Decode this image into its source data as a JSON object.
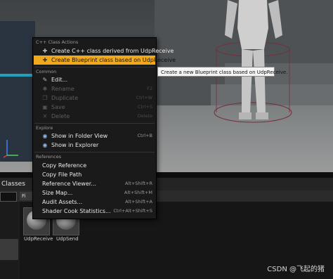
{
  "menu": {
    "sections": [
      {
        "header": "C++ Class Actions",
        "items": [
          {
            "label": "Create C++ class derived from UdpReceive",
            "shortcut": "",
            "icon": "cpp-class-icon",
            "disabled": false,
            "highlighted": false
          },
          {
            "label": "Create Blueprint class based on UdpReceive",
            "shortcut": "",
            "icon": "blueprint-class-icon",
            "disabled": false,
            "highlighted": true
          }
        ]
      },
      {
        "header": "Common",
        "items": [
          {
            "label": "Edit...",
            "shortcut": "",
            "icon": "edit-icon",
            "disabled": false
          },
          {
            "label": "Rename",
            "shortcut": "F2",
            "icon": "rename-icon",
            "disabled": true
          },
          {
            "label": "Duplicate",
            "shortcut": "Ctrl+W",
            "icon": "duplicate-icon",
            "disabled": true
          },
          {
            "label": "Save",
            "shortcut": "Ctrl+S",
            "icon": "save-icon",
            "disabled": true
          },
          {
            "label": "Delete",
            "shortcut": "Delete",
            "icon": "delete-icon",
            "disabled": true
          }
        ]
      },
      {
        "header": "Explore",
        "items": [
          {
            "label": "Show in Folder View",
            "shortcut": "Ctrl+B",
            "icon": "folder-view-icon",
            "disabled": false
          },
          {
            "label": "Show in Explorer",
            "shortcut": "",
            "icon": "explorer-icon",
            "disabled": false
          }
        ]
      },
      {
        "header": "References",
        "items": [
          {
            "label": "Copy Reference",
            "shortcut": "",
            "disabled": false
          },
          {
            "label": "Copy File Path",
            "shortcut": "",
            "disabled": false
          },
          {
            "label": "Reference Viewer...",
            "shortcut": "Alt+Shift+R",
            "disabled": false
          },
          {
            "label": "Size Map...",
            "shortcut": "Alt+Shift+M",
            "disabled": false
          },
          {
            "label": "Audit Assets...",
            "shortcut": "Alt+Shift+A",
            "disabled": false
          },
          {
            "label": "Shader Cook Statistics...",
            "shortcut": "Ctrl+Alt+Shift+S",
            "disabled": false
          }
        ]
      }
    ]
  },
  "tooltip": {
    "text": "Create a new Blueprint class based on UdpReceive."
  },
  "content_browser": {
    "tab_label": "Classes",
    "filter_label": "Fi",
    "assets": [
      {
        "name": "UdpReceive"
      },
      {
        "name": "UdpSend"
      }
    ]
  },
  "watermark": "CSDN @飞起的猪",
  "colors": {
    "highlight": "#f0a91c",
    "menu_bg": "#1a1a1a",
    "tooltip_bg": "#f4f4f4"
  }
}
